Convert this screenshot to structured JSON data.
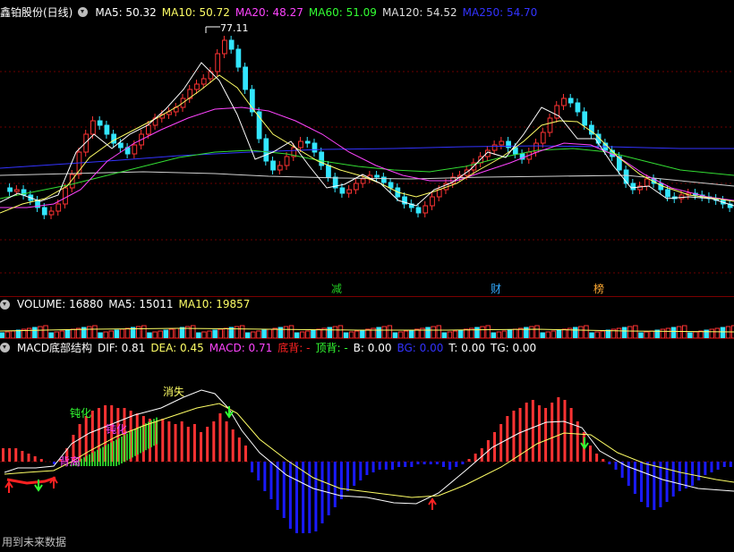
{
  "main": {
    "title": "鑫铂股份(日线)",
    "indicators": [
      {
        "label": "MA5: 50.32",
        "color": "#ffffff"
      },
      {
        "label": "MA10: 50.72",
        "color": "#ffff66"
      },
      {
        "label": "MA20: 48.27",
        "color": "#ff44ff"
      },
      {
        "label": "MA60: 51.09",
        "color": "#33ff33"
      },
      {
        "label": "MA120: 54.52",
        "color": "#dddddd"
      },
      {
        "label": "MA250: 54.70",
        "color": "#3333ff"
      }
    ],
    "high_price_label": "77.11",
    "event_labels": [
      {
        "text": "减",
        "color": "#22cc22"
      },
      {
        "text": "财",
        "color": "#33aaff"
      },
      {
        "text": "榜",
        "color": "#ffaa33"
      }
    ]
  },
  "volume": {
    "indicators": [
      {
        "label": "VOLUME: 16880",
        "color": "#ffffff"
      },
      {
        "label": "MA5: 15011",
        "color": "#ffffff"
      },
      {
        "label": "MA10: 19857",
        "color": "#ffff66"
      }
    ]
  },
  "macd": {
    "name": "MACD底部结构",
    "indicators": [
      {
        "label": "DIF: 0.81",
        "color": "#ffffff"
      },
      {
        "label": "DEA: 0.45",
        "color": "#ffff66"
      },
      {
        "label": "MACD: 0.71",
        "color": "#ff44ff"
      },
      {
        "label": "底背: -",
        "color": "#ff2222"
      },
      {
        "label": "顶背: -",
        "color": "#33ff33"
      },
      {
        "label": "B: 0.00",
        "color": "#ffffff"
      },
      {
        "label": "BG: 0.00",
        "color": "#3333ff"
      },
      {
        "label": "T: 0.00",
        "color": "#ffffff"
      },
      {
        "label": "TG: 0.00",
        "color": "#ffffff"
      }
    ],
    "annotations": [
      {
        "text": "钝化",
        "color": "#33ff33"
      },
      {
        "text": "钝化",
        "color": "#ff44ff"
      },
      {
        "text": "消失",
        "color": "#ffff66"
      },
      {
        "text": "背离",
        "color": "#ff44ff"
      }
    ]
  },
  "footer": "用到未来数据",
  "colors": {
    "up": "#ff3333",
    "down": "#33e6ff",
    "grid": "#7a0000"
  }
}
